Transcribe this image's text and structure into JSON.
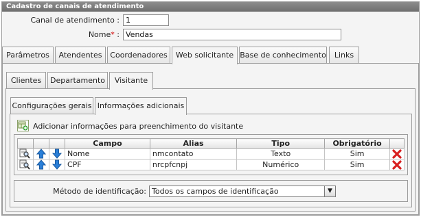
{
  "panel": {
    "title": "Cadastro de canais de atendimento"
  },
  "form": {
    "channel_label": "Canal de atendimento :",
    "channel_value": "1",
    "name_label": "Nome",
    "name_required": "*",
    "name_colon": ":",
    "name_value": "Vendas"
  },
  "tabs_main": [
    "Parâmetros",
    "Atendentes",
    "Coordenadores",
    "Web solicitante",
    "Base de conhecimento",
    "Links"
  ],
  "tabs_sub": [
    "Clientes",
    "Departamento",
    "Visitante"
  ],
  "tabs_inner": [
    "Configurações gerais",
    "Informações adicionais"
  ],
  "add_info": {
    "label": "Adicionar informações para preenchimento do visitante"
  },
  "table": {
    "headers": {
      "campo": "Campo",
      "alias": "Alias",
      "tipo": "Tipo",
      "obrigatorio": "Obrigatório"
    },
    "rows": [
      {
        "campo": "Nome",
        "alias": "nmcontato",
        "tipo": "Texto",
        "obrigatorio": "Sim"
      },
      {
        "campo": "CPF",
        "alias": "nrcpfcnpj",
        "tipo": "Numérico",
        "obrigatorio": "Sim"
      }
    ]
  },
  "identification": {
    "label": "Método de identificação:",
    "selected": "Todos os campos de identificação"
  },
  "colors": {
    "title_bar": "#7a7a7a",
    "required": "#d00000",
    "delete": "#d81f1f",
    "arrow": "#2a7fd8"
  }
}
